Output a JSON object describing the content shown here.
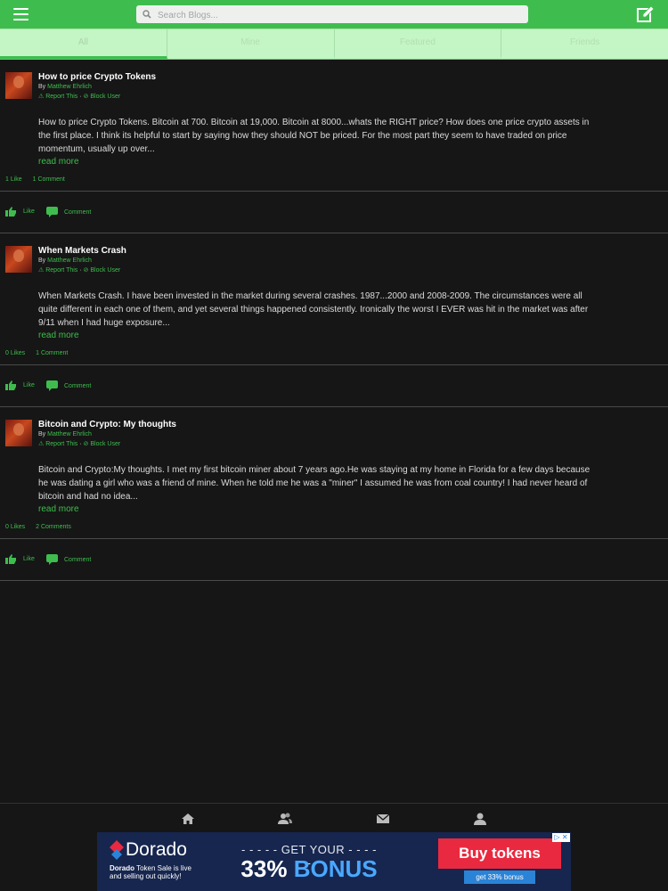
{
  "header": {
    "menu_icon": "hamburger-icon",
    "search_placeholder": "Search Blogs...",
    "compose_icon": "compose-icon",
    "accent_color": "#3ebd4e"
  },
  "tabs": [
    {
      "label": "All",
      "active": true
    },
    {
      "label": "Mine",
      "active": false
    },
    {
      "label": "Featured",
      "active": false
    },
    {
      "label": "Friends",
      "active": false
    }
  ],
  "posts": [
    {
      "title": "How to price Crypto Tokens",
      "by": "By",
      "author": "Matthew Ehrlich",
      "report": "Report This",
      "separator": "·",
      "block": "Block User",
      "excerpt": "How to price Crypto Tokens. Bitcoin at 700. Bitcoin at 19,000. Bitcoin at 8000...whats the RIGHT price? How does one price crypto assets in the first place. I think its helpful to start by saying how they should NOT be priced. For the most part they seem to have traded on price momentum, usually up over...",
      "read_more": "read more",
      "likes": "1 Like",
      "comments": "1 Comment",
      "like_label": "Like",
      "comment_label": "Comment"
    },
    {
      "title": "When Markets Crash",
      "by": "By",
      "author": "Matthew Ehrlich",
      "report": "Report This",
      "separator": "·",
      "block": "Block User",
      "excerpt": "When Markets Crash. I have been invested in the market during several crashes. 1987...2000 and 2008-2009. The circumstances were all quite different in each one of them, and yet several things happened consistently. Ironically the worst I EVER was hit in the market was after 9/11 when I had huge exposure...",
      "read_more": "read more",
      "likes": "0 Likes",
      "comments": "1 Comment",
      "like_label": "Like",
      "comment_label": "Comment"
    },
    {
      "title": "Bitcoin and Crypto: My thoughts",
      "by": "By",
      "author": "Matthew Ehrlich",
      "report": "Report This",
      "separator": "·",
      "block": "Block User",
      "excerpt": "Bitcoin and Crypto:My thoughts. I met my first bitcoin miner about 7 years ago.He was staying at my home in Florida for a few days because he was dating a girl who was a friend of mine.  When he told me he was a \"miner\" I assumed he was from coal country!  I had never heard of bitcoin and had no idea...",
      "read_more": "read more",
      "likes": "0 Likes",
      "comments": "2 Comments",
      "like_label": "Like",
      "comment_label": "Comment"
    }
  ],
  "bottom_nav": [
    "home-icon",
    "friends-icon",
    "messages-icon",
    "profile-icon"
  ],
  "ad": {
    "brand": "Dorado",
    "brand_sub_bold": "Dorado",
    "brand_sub_1": "Token Sale is live",
    "brand_sub_2": "and selling out quickly!",
    "get_your": "- - - - - GET YOUR - - - - -",
    "bonus_pct": "33%",
    "bonus_word": "BONUS",
    "buy_label": "Buy tokens",
    "get_bonus_label": "get 33% bonus",
    "close_label": "▷ ✕"
  }
}
